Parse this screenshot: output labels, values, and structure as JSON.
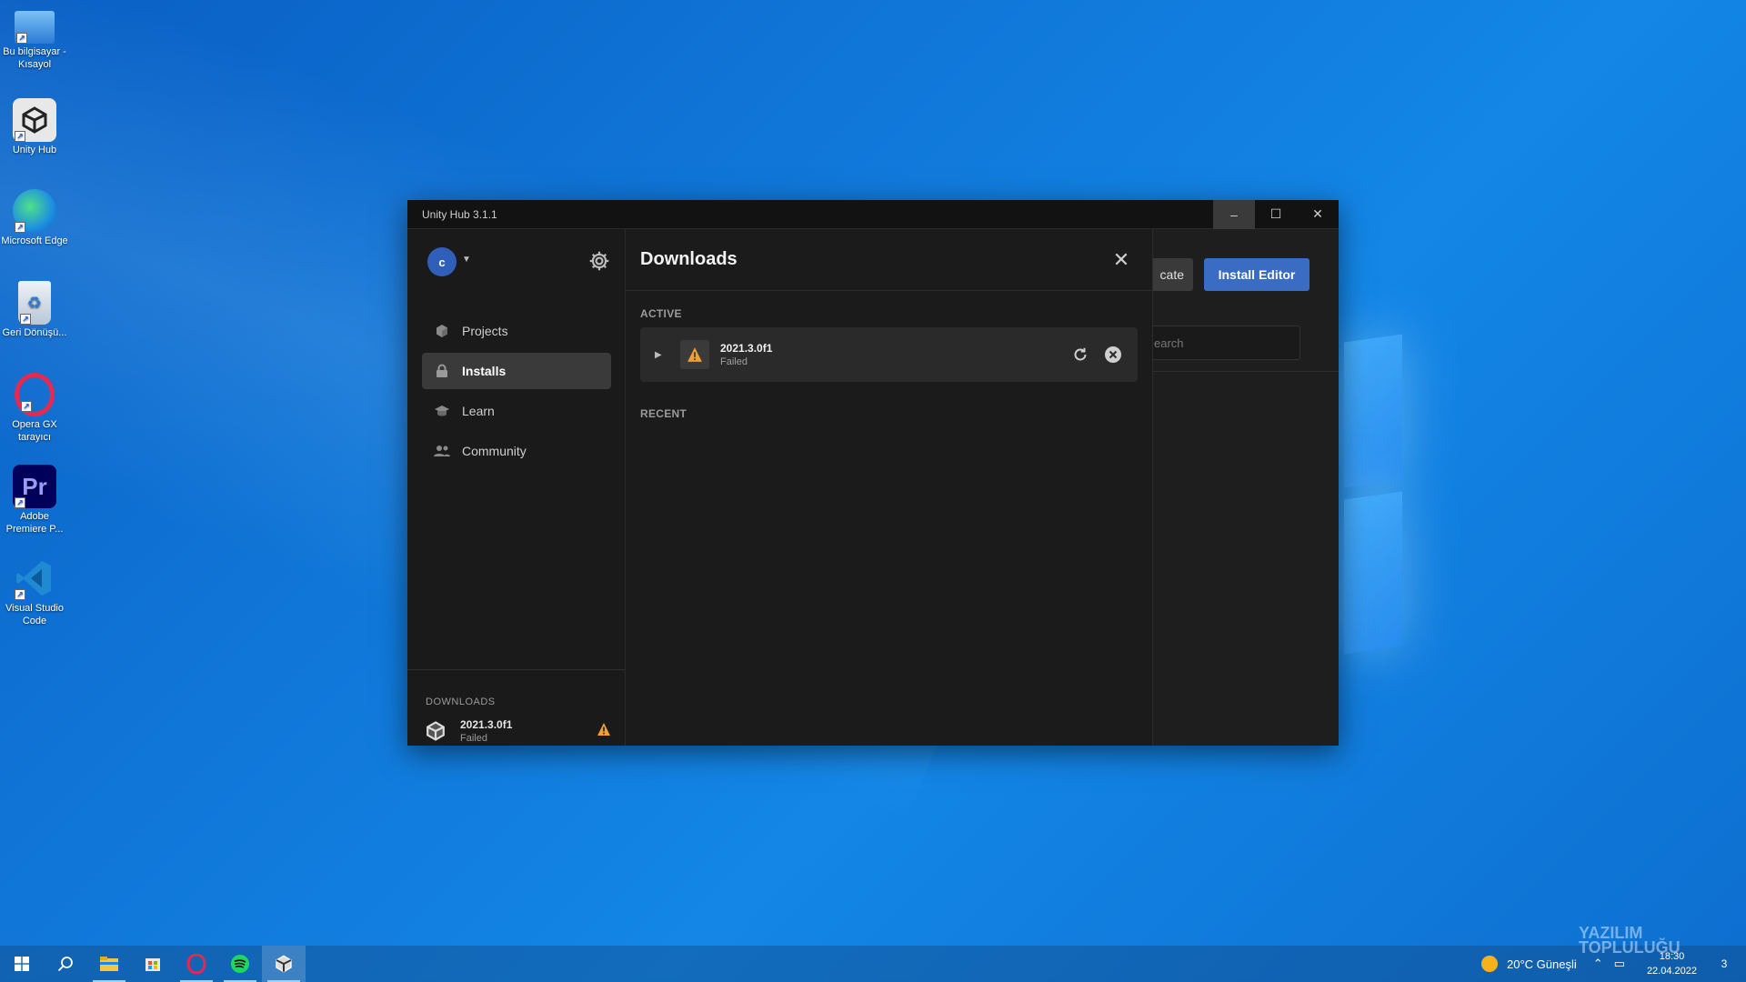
{
  "desktop": {
    "icons": [
      {
        "label": "Bu bilgisayar - Kısayol",
        "icon": "computer-icon"
      },
      {
        "label": "Unity Hub",
        "icon": "unity-icon"
      },
      {
        "label": "Microsoft Edge",
        "icon": "edge-icon"
      },
      {
        "label": "Geri Dönüşü...",
        "icon": "recycle-bin-icon"
      },
      {
        "label": "Opera GX tarayıcı",
        "icon": "opera-icon"
      },
      {
        "label": "Adobe Premiere P...",
        "icon": "premiere-icon",
        "glyph": "Pr"
      },
      {
        "label": "Visual Studio Code",
        "icon": "vscode-icon"
      }
    ]
  },
  "window": {
    "title": "Unity Hub 3.1.1",
    "min": "–",
    "max": "☐",
    "close": "✕"
  },
  "sidebar": {
    "avatar_initial": "c",
    "nav": [
      {
        "label": "Projects",
        "icon": "cube-icon"
      },
      {
        "label": "Installs",
        "icon": "lock-icon",
        "active": true
      },
      {
        "label": "Learn",
        "icon": "graduation-cap-icon"
      },
      {
        "label": "Community",
        "icon": "people-icon"
      }
    ],
    "downloads_header": "DOWNLOADS",
    "download": {
      "version": "2021.3.0f1",
      "status": "Failed"
    }
  },
  "downloads_panel": {
    "title": "Downloads",
    "active_label": "ACTIVE",
    "recent_label": "RECENT",
    "active_item": {
      "version": "2021.3.0f1",
      "status": "Failed"
    }
  },
  "background_content": {
    "locate_label": "cate",
    "install_editor_label": "Install Editor",
    "search_placeholder": "earch"
  },
  "taskbar": {
    "weather": "20°C  Güneşli",
    "time": "18:30",
    "date": "22.04.2022",
    "notifications": "3"
  },
  "watermark": {
    "line1": "YAZILIM",
    "line2": "TOPLULUĞU"
  },
  "colors": {
    "accent": "#3a6cc4",
    "warning": "#f0a033",
    "window_bg": "#1e1e1e"
  }
}
